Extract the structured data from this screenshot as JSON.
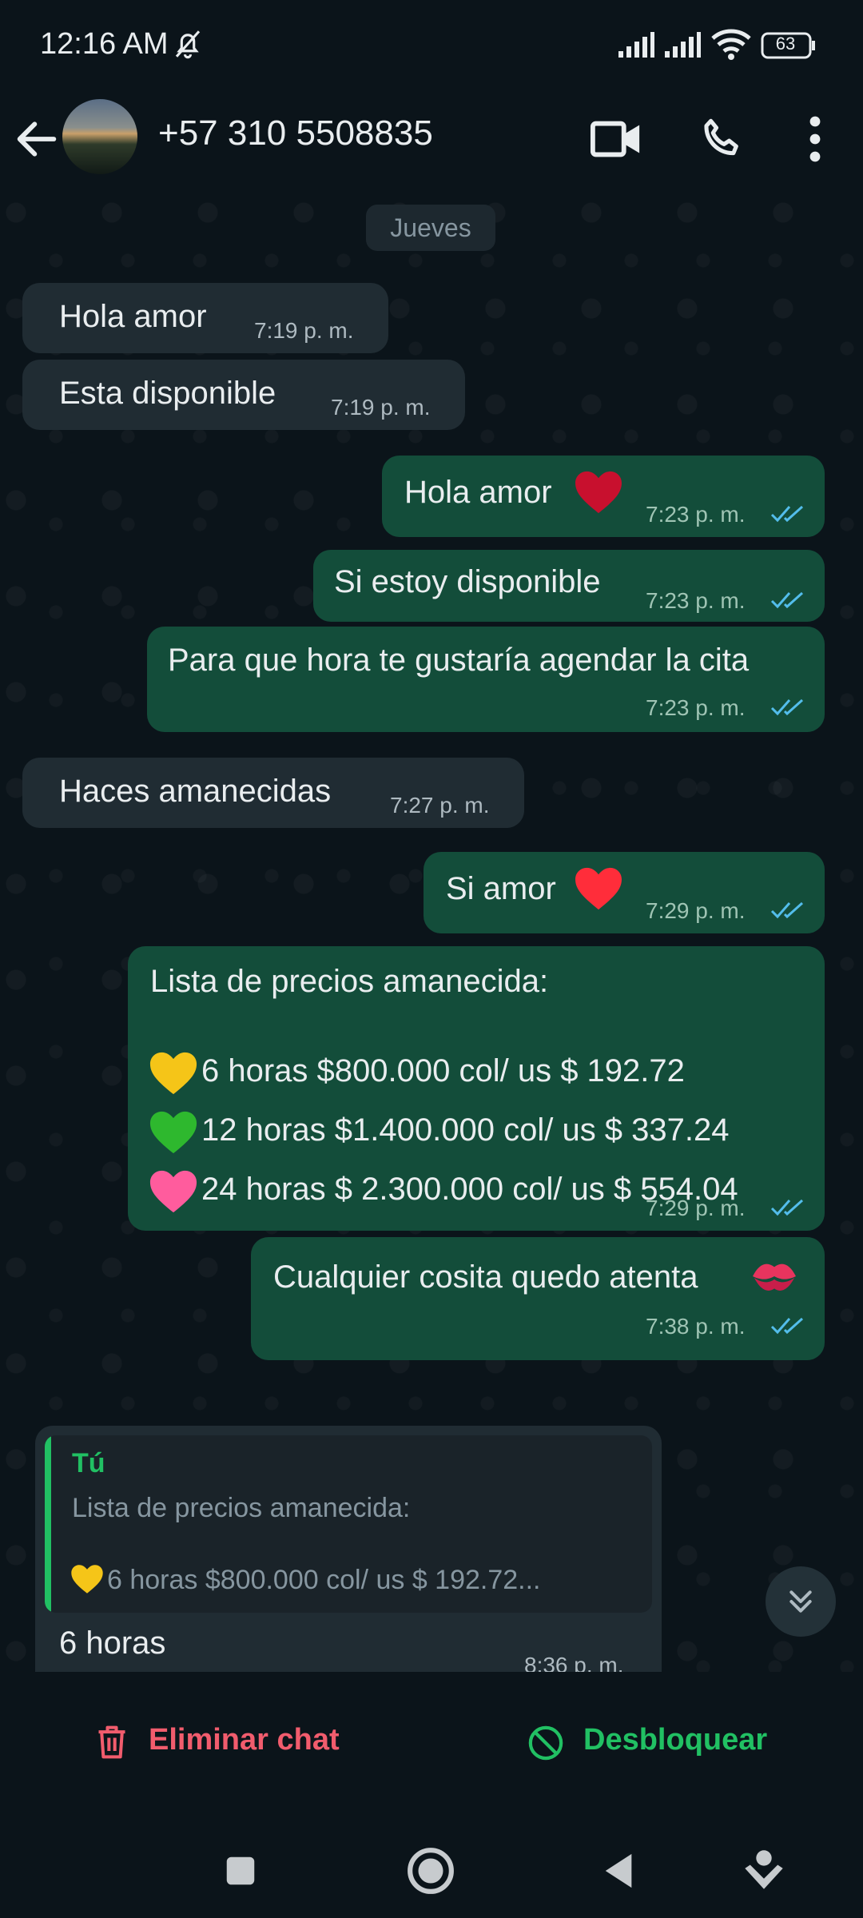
{
  "status_bar": {
    "time": "12:16 AM",
    "battery": "63"
  },
  "header": {
    "contact": "+57 310 5508835"
  },
  "chat": {
    "day_label": "Jueves",
    "messages": [
      {
        "dir": "in",
        "text": "Hola amor",
        "time": "7:19 p. m."
      },
      {
        "dir": "in",
        "text": "Esta disponible",
        "time": "7:19 p. m."
      },
      {
        "dir": "out",
        "text": "Hola amor",
        "time": "7:23 p. m."
      },
      {
        "dir": "out",
        "text": "Si estoy disponible",
        "time": "7:23 p. m."
      },
      {
        "dir": "out",
        "text": "Para que hora te gustaría agendar la cita",
        "time": "7:23 p. m."
      },
      {
        "dir": "in",
        "text": "Haces amanecidas",
        "time": "7:27 p. m."
      },
      {
        "dir": "out",
        "text": "Si amor",
        "time": "7:29 p. m."
      },
      {
        "dir": "out",
        "title": "Lista de precios amanecida:",
        "lines": [
          "6 horas $800.000 col/ us $ 192.72",
          "12 horas $1.400.000 col/ us $ 337.24",
          "24 horas $ 2.300.000 col/ us $ 554.04"
        ],
        "time": "7:29 p. m."
      },
      {
        "dir": "out",
        "text": "Cualquier cosita quedo atenta",
        "time": "7:38 p. m."
      },
      {
        "dir": "in",
        "reply_author": "Tú",
        "reply_title": "Lista de precios amanecida:",
        "reply_line": "6 horas $800.000 col/ us $ 192.72...",
        "text": "6 horas",
        "time": "8:36 p. m."
      }
    ]
  },
  "actions": {
    "delete": "Eliminar chat",
    "unblock": "Desbloquear"
  },
  "colors": {
    "incoming": "#202c33",
    "outgoing": "#134d3a",
    "delete": "#f15c6d",
    "unblock": "#21c063",
    "ticks": "#53bdeb"
  }
}
